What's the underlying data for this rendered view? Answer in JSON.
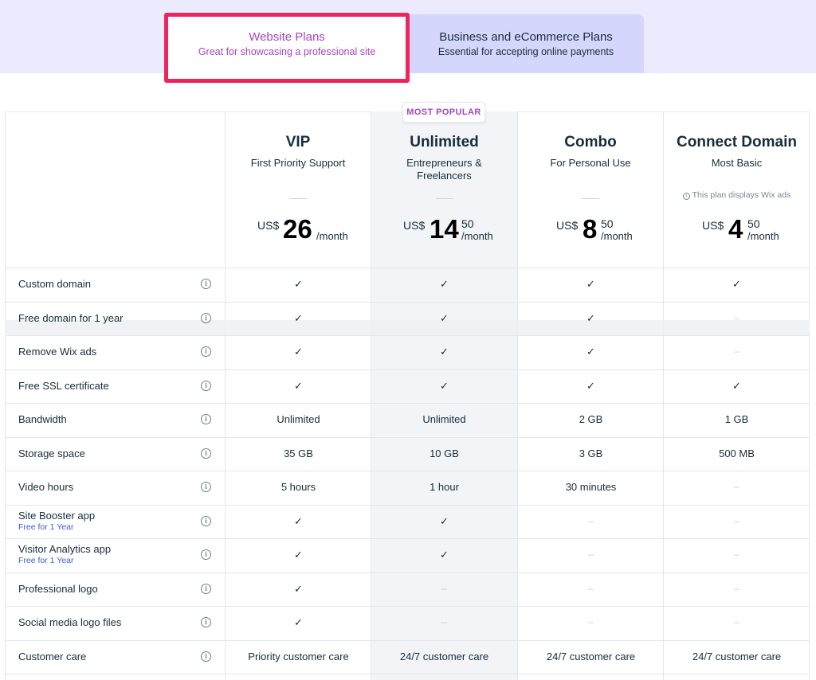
{
  "tabs": [
    {
      "title": "Website Plans",
      "subtitle": "Great for showcasing a professional site"
    },
    {
      "title": "Business and eCommerce Plans",
      "subtitle": "Essential for accepting online payments"
    }
  ],
  "badge": "MOST POPULAR",
  "plans": [
    {
      "name": "VIP",
      "description": "First Priority Support",
      "note": "",
      "currency": "US$",
      "whole": "26",
      "cents": "",
      "per": "/month"
    },
    {
      "name": "Unlimited",
      "description": "Entrepreneurs & Freelancers",
      "note": "",
      "currency": "US$",
      "whole": "14",
      "cents": "50",
      "per": "/month"
    },
    {
      "name": "Combo",
      "description": "For Personal Use",
      "note": "",
      "currency": "US$",
      "whole": "8",
      "cents": "50",
      "per": "/month"
    },
    {
      "name": "Connect Domain",
      "description": "Most Basic",
      "note": "This plan displays Wix ads",
      "currency": "US$",
      "whole": "4",
      "cents": "50",
      "per": "/month"
    }
  ],
  "features": [
    {
      "label": "Custom domain",
      "sub": "",
      "values": [
        "✓",
        "✓",
        "✓",
        "✓"
      ]
    },
    {
      "label": "Free domain for 1 year",
      "sub": "",
      "values": [
        "✓",
        "✓",
        "✓",
        "–"
      ]
    },
    {
      "label": "Remove Wix ads",
      "sub": "",
      "values": [
        "✓",
        "✓",
        "✓",
        "–"
      ]
    },
    {
      "label": "Free SSL certificate",
      "sub": "",
      "values": [
        "✓",
        "✓",
        "✓",
        "✓"
      ]
    },
    {
      "label": "Bandwidth",
      "sub": "",
      "values": [
        "Unlimited",
        "Unlimited",
        "2 GB",
        "1 GB"
      ]
    },
    {
      "label": "Storage space",
      "sub": "",
      "values": [
        "35 GB",
        "10 GB",
        "3 GB",
        "500 MB"
      ]
    },
    {
      "label": "Video hours",
      "sub": "",
      "values": [
        "5 hours",
        "1 hour",
        "30 minutes",
        "–"
      ]
    },
    {
      "label": "Site Booster app",
      "sub": "Free for 1 Year",
      "values": [
        "✓",
        "✓",
        "–",
        "–"
      ]
    },
    {
      "label": "Visitor Analytics app",
      "sub": "Free for 1 Year",
      "values": [
        "✓",
        "✓",
        "–",
        "–"
      ]
    },
    {
      "label": "Professional logo",
      "sub": "",
      "values": [
        "✓",
        "–",
        "–",
        "–"
      ]
    },
    {
      "label": "Social media logo files",
      "sub": "",
      "values": [
        "✓",
        "–",
        "–",
        "–"
      ]
    },
    {
      "label": "Customer care",
      "sub": "",
      "values": [
        "Priority customer care",
        "24/7 customer care",
        "24/7 customer care",
        "24/7 customer care"
      ]
    }
  ],
  "colors": {
    "accent": "#a844c0",
    "highlight_border": "#f0245d",
    "tab_band": "#ebebfd",
    "tab_inactive": "#d5d6fb"
  }
}
